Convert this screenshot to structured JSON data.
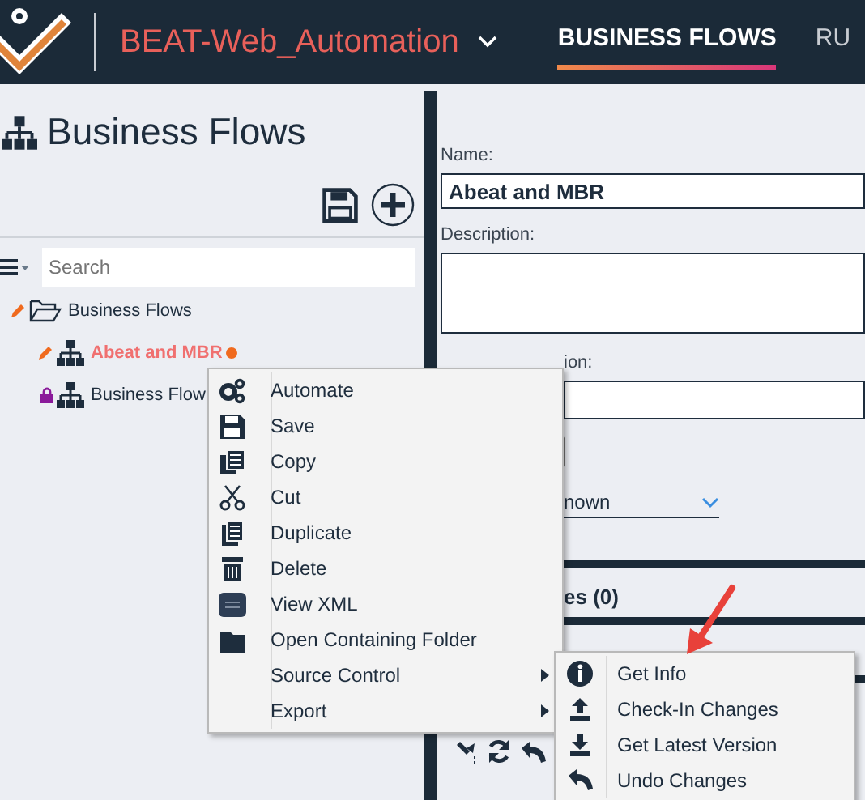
{
  "app_bar": {
    "project": "BEAT-Web_Automation",
    "tabs": [
      {
        "label": "BUSINESS FLOWS",
        "selected": true
      },
      {
        "label": "RU",
        "selected": false
      }
    ]
  },
  "left_panel": {
    "title": "Business Flows",
    "search": {
      "placeholder": "Search"
    },
    "tree": [
      {
        "label": "Business Flows",
        "kind": "folder",
        "modified": true,
        "unsaved": false,
        "locked": false,
        "selected": false,
        "children": [
          {
            "label": "Abeat and MBR",
            "kind": "flow",
            "modified": true,
            "unsaved": true,
            "locked": false,
            "selected": true
          },
          {
            "label": "Business Flow",
            "kind": "flow",
            "modified": false,
            "unsaved": false,
            "locked": true,
            "selected": false
          }
        ]
      }
    ]
  },
  "details": {
    "name_label": "Name:",
    "name_value": "Abeat and MBR",
    "description_label": "Description:",
    "run_description_label": "ion:",
    "status_value": "nown",
    "section_title": "es (0)"
  },
  "context_menu": {
    "items": [
      {
        "label": "Automate",
        "has_submenu": false
      },
      {
        "label": "Save",
        "has_submenu": false
      },
      {
        "label": "Copy",
        "has_submenu": false
      },
      {
        "label": "Cut",
        "has_submenu": false
      },
      {
        "label": "Duplicate",
        "has_submenu": false
      },
      {
        "label": "Delete",
        "has_submenu": false
      },
      {
        "label": "View XML",
        "has_submenu": false
      },
      {
        "label": "Open Containing Folder",
        "has_submenu": false
      },
      {
        "label": "Source Control",
        "has_submenu": true
      },
      {
        "label": "Export",
        "has_submenu": true
      }
    ]
  },
  "submenu": {
    "items": [
      {
        "label": "Get Info"
      },
      {
        "label": "Check-In Changes"
      },
      {
        "label": "Get Latest Version"
      },
      {
        "label": "Undo Changes"
      }
    ]
  }
}
